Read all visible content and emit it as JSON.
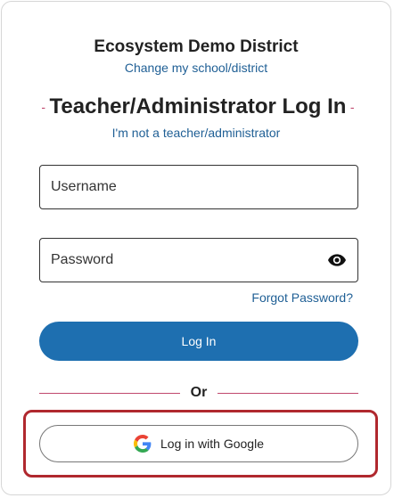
{
  "header": {
    "district_name": "Ecosystem Demo District",
    "change_link": "Change my school/district",
    "title": "Teacher/Administrator Log In",
    "title_dash": "-",
    "not_teacher_link": "I'm not a teacher/administrator"
  },
  "form": {
    "username_placeholder": "Username",
    "username_value": "",
    "password_placeholder": "Password",
    "password_value": "",
    "forgot_link": "Forgot Password?",
    "login_label": "Log In"
  },
  "divider": {
    "or_text": "Or"
  },
  "sso": {
    "google_label": "Log in with Google",
    "google_icon": "google-g-icon"
  },
  "colors": {
    "accent_blue": "#1e6fb0",
    "link_blue": "#1f5f95",
    "divider_pink": "#c0486e",
    "highlight_red": "#b0282e"
  },
  "icons": {
    "password_toggle": "eye-icon"
  }
}
